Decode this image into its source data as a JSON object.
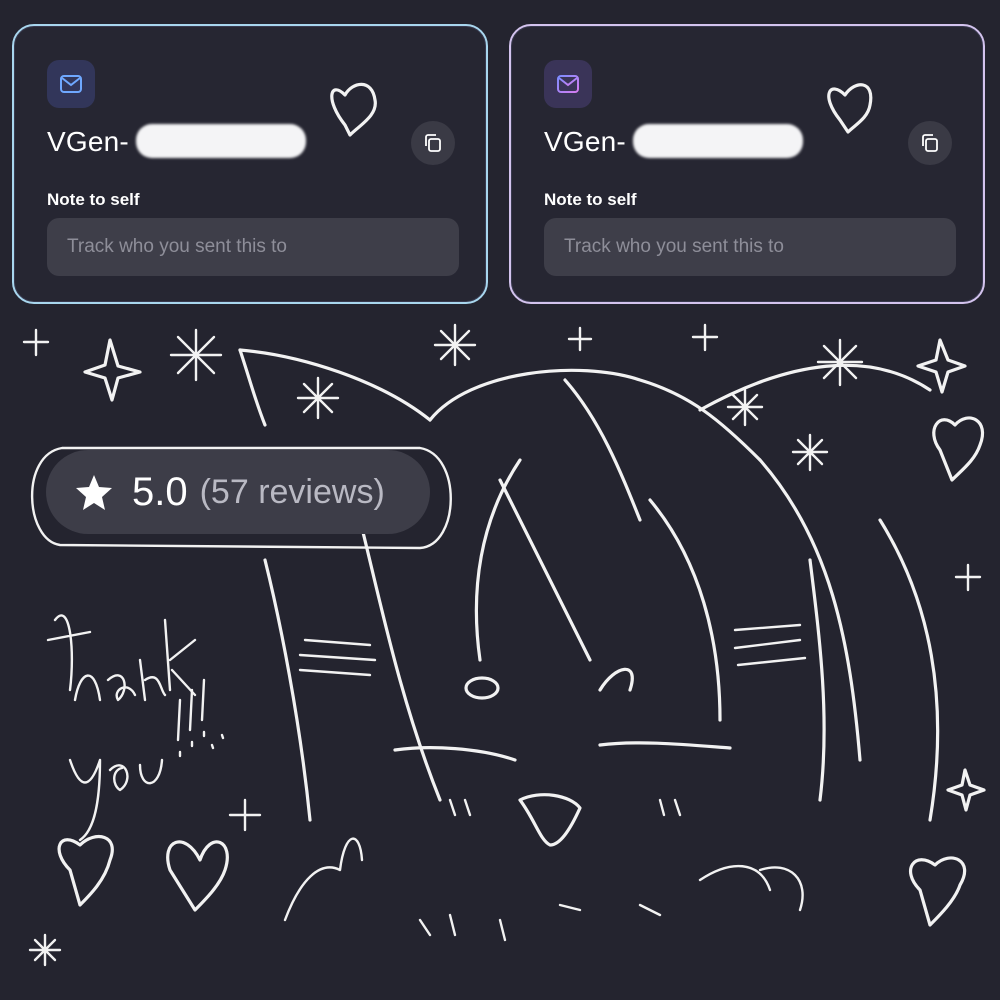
{
  "cards": [
    {
      "mail_icon": "mail-icon",
      "title": "VGen-",
      "copy_icon": "copy-icon",
      "note_label": "Note to self",
      "note_placeholder": "Track who you sent this to",
      "accent": "#7aa7f0"
    },
    {
      "mail_icon": "mail-icon",
      "title": "VGen-",
      "copy_icon": "copy-icon",
      "note_label": "Note to self",
      "note_placeholder": "Track who you sent this to",
      "accent": "#b28cf0"
    }
  ],
  "rating": {
    "icon": "star-icon",
    "value": "5.0",
    "reviews": "(57 reviews)",
    "stars": 5.0
  },
  "doodle": {
    "text": "thank you!!!..",
    "color": "#f2f2f2"
  },
  "colors": {
    "background": "#24242f",
    "card": "#262632",
    "input": "#3e3e49",
    "pill": "#3d3d48"
  }
}
